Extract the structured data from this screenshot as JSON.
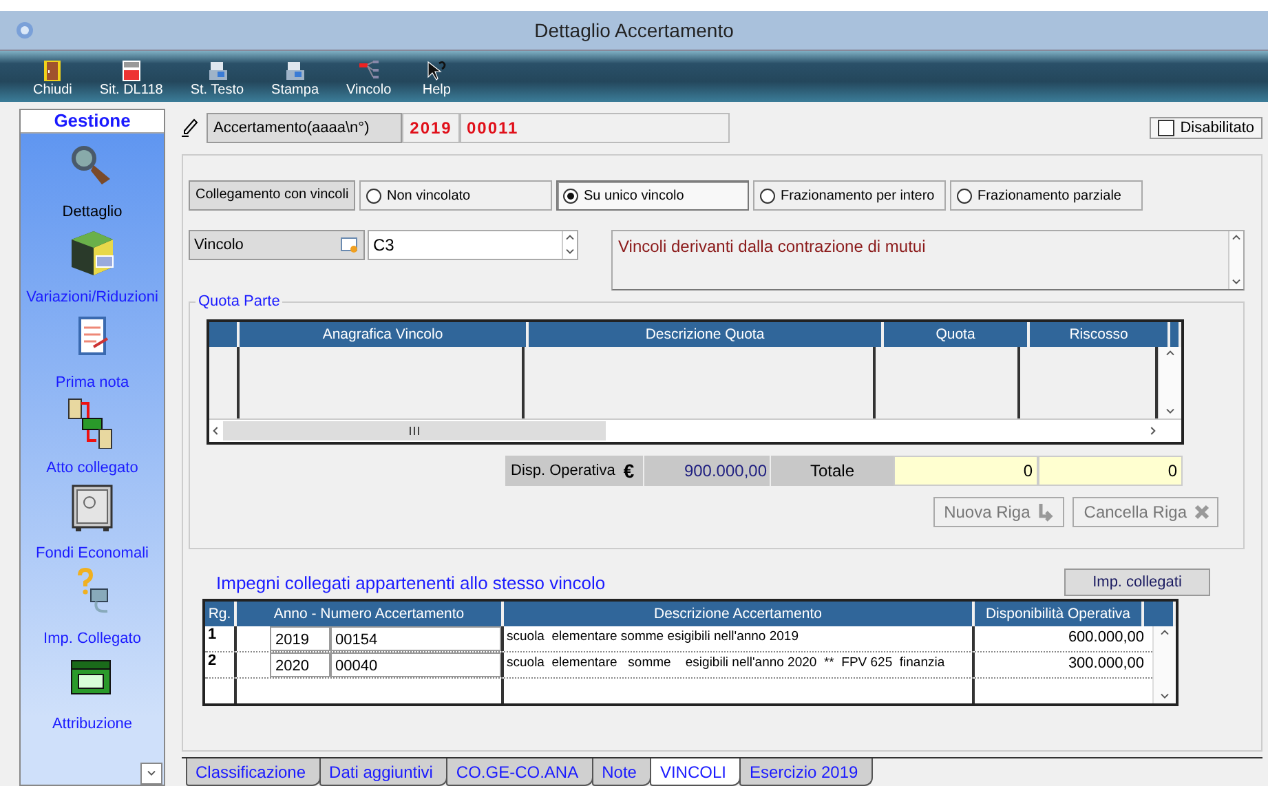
{
  "window": {
    "title": "Dettaglio Accertamento"
  },
  "toolbar": [
    {
      "label": "Chiudi",
      "kind": "door"
    },
    {
      "label": "Sit. DL118",
      "kind": "sheet"
    },
    {
      "label": "St. Testo",
      "kind": "printer"
    },
    {
      "label": "Stampa",
      "kind": "printer"
    },
    {
      "label": "Vincolo",
      "kind": "tree"
    },
    {
      "label": "Help",
      "kind": "help"
    }
  ],
  "sidebar": {
    "title": "Gestione",
    "items": [
      {
        "label": "Dettaglio",
        "kind": "magnifier",
        "selected": true
      },
      {
        "label": "Variazioni/Riduzioni",
        "kind": "cube",
        "selected": false
      },
      {
        "label": "Prima nota",
        "kind": "notepad",
        "selected": false
      },
      {
        "label": "Atto collegato",
        "kind": "link",
        "selected": false
      },
      {
        "label": "Fondi Economali",
        "kind": "safe",
        "selected": false
      },
      {
        "label": "Imp. Collegato",
        "kind": "plug",
        "selected": false
      },
      {
        "label": "Attribuzione",
        "kind": "money",
        "selected": false
      }
    ]
  },
  "header": {
    "label": "Accertamento(aaaa\\n°)",
    "year": "2019",
    "number": "00011",
    "disabled_checkbox": {
      "label": "Disabilitato",
      "checked": false
    }
  },
  "collegamento": {
    "label": "Collegamento con vincoli",
    "options": [
      {
        "label": "Non vincolato",
        "selected": false
      },
      {
        "label": "Su unico vincolo",
        "selected": true
      },
      {
        "label": "Frazionamento per intero",
        "selected": false
      },
      {
        "label": "Frazionamento parziale",
        "selected": false
      }
    ]
  },
  "vincolo": {
    "label": "Vincolo",
    "value": "C3",
    "description": "Vincoli derivanti dalla contrazione di mutui"
  },
  "quota_parte": {
    "title": "Quota Parte",
    "columns": [
      "Anagrafica Vincolo",
      "Descrizione Quota",
      "Quota",
      "Riscosso"
    ],
    "disp_label": "Disp. Operativa",
    "currency": "€",
    "disp_value": "900.000,00",
    "totale_label": "Totale",
    "totale_quota": "0",
    "totale_riscosso": "0",
    "buttons": [
      {
        "label": "Nuova Riga",
        "kind": "add",
        "disabled": true
      },
      {
        "label": "Cancella Riga",
        "kind": "delete",
        "disabled": true
      }
    ]
  },
  "impegni": {
    "title": "Impegni collegati appartenenti allo stesso vincolo",
    "button": "Imp. collegati",
    "columns": [
      "Rg.",
      "Anno - Numero Accertamento",
      "Descrizione Accertamento",
      "Disponibilità Operativa"
    ],
    "rows": [
      {
        "rg": "1",
        "anno": "2019",
        "numero": "00154",
        "descrizione": "scuola  elementare somme esigibili nell'anno 2019",
        "disponibilita": "600.000,00"
      },
      {
        "rg": "2",
        "anno": "2020",
        "numero": "00040",
        "descrizione": "scuola  elementare   somme    esigibili nell'anno 2020  **  FPV 625  finanzia",
        "disponibilita": "300.000,00"
      }
    ]
  },
  "tabs": [
    {
      "label": "Classificazione",
      "selected": false
    },
    {
      "label": "Dati aggiuntivi",
      "selected": false
    },
    {
      "label": "CO.GE-CO.ANA",
      "selected": false
    },
    {
      "label": "Note",
      "selected": false
    },
    {
      "label": "VINCOLI",
      "selected": true
    },
    {
      "label": "Esercizio 2019",
      "selected": false
    }
  ]
}
